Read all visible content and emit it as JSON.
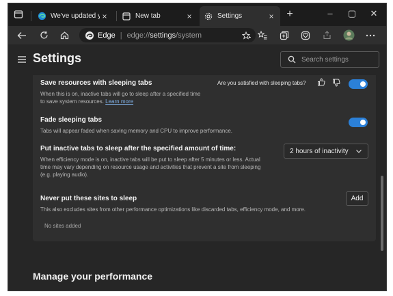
{
  "tabs": [
    {
      "label": "We've updated you",
      "close": "×",
      "icon": "edge-logo-icon"
    },
    {
      "label": "New tab",
      "close": "×",
      "icon": "newtab-page-icon"
    },
    {
      "label": "Settings",
      "close": "×",
      "icon": "gear-icon"
    }
  ],
  "window_controls": {
    "new_tab": "+",
    "minimize": "–",
    "maximize": "▢",
    "close": "✕"
  },
  "address_bar": {
    "site": "Edge",
    "divider": "|",
    "url_prefix": "edge://",
    "url_main": "settings",
    "url_suffix": "/system"
  },
  "settings_header": {
    "title": "Settings",
    "search_placeholder": "Search settings"
  },
  "sleeping_tabs": {
    "title": "Save resources with sleeping tabs",
    "description_line1": "When this is on, inactive tabs will go to sleep after a specified time",
    "description_line2": "to save system resources.",
    "learn_more": "Learn more",
    "feedback_question": "Are you satisfied with sleeping tabs?",
    "enabled": true
  },
  "fade_tabs": {
    "title": "Fade sleeping tabs",
    "description": "Tabs will appear faded when saving memory and CPU to improve performance.",
    "enabled": true
  },
  "inactive_timer": {
    "title": "Put inactive tabs to sleep after the specified amount of time:",
    "description_line1": "When efficiency mode is on, inactive tabs will be put to sleep after 5 minutes or less. Actual",
    "description_line2": "time may vary depending on resource usage and activities that prevent a site from sleeping",
    "description_line3": "(e.g. playing audio).",
    "selected": "2 hours of inactivity"
  },
  "never_sleep": {
    "title": "Never put these sites to sleep",
    "description": "This also excludes sites from other performance optimizations like discarded tabs, efficiency mode, and more.",
    "add_label": "Add",
    "empty_text": "No sites added"
  },
  "performance": {
    "title": "Manage your performance"
  },
  "colors": {
    "accent": "#2b80d8",
    "background": "#262626",
    "card": "#2f2f2f"
  }
}
